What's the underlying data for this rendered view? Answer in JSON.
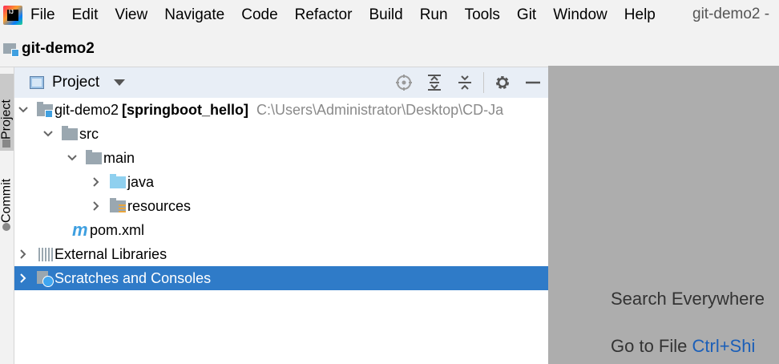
{
  "menu": {
    "items": [
      "File",
      "Edit",
      "View",
      "Navigate",
      "Code",
      "Refactor",
      "Build",
      "Run",
      "Tools",
      "Git",
      "Window",
      "Help"
    ],
    "window_title": "git-demo2 -"
  },
  "navbar": {
    "project_name": "git-demo2"
  },
  "toolstrip": {
    "project_tab": "Project",
    "commit_tab": "Commit"
  },
  "panel": {
    "title": "Project"
  },
  "tree": {
    "root": {
      "name": "git-demo2",
      "module": "[springboot_hello]",
      "path": "C:\\Users\\Administrator\\Desktop\\CD-Ja"
    },
    "src": "src",
    "main": "main",
    "java": "java",
    "resources": "resources",
    "pom": "pom.xml",
    "external": "External Libraries",
    "scratches": "Scratches and Consoles"
  },
  "editor": {
    "search_everywhere": "Search Everywhere",
    "goto_file": "Go to File",
    "goto_file_shortcut": "Ctrl+Shi"
  },
  "colors": {
    "selection": "#2f7bc8",
    "panel_header": "#e8eef6",
    "editor_bg": "#adadad"
  }
}
